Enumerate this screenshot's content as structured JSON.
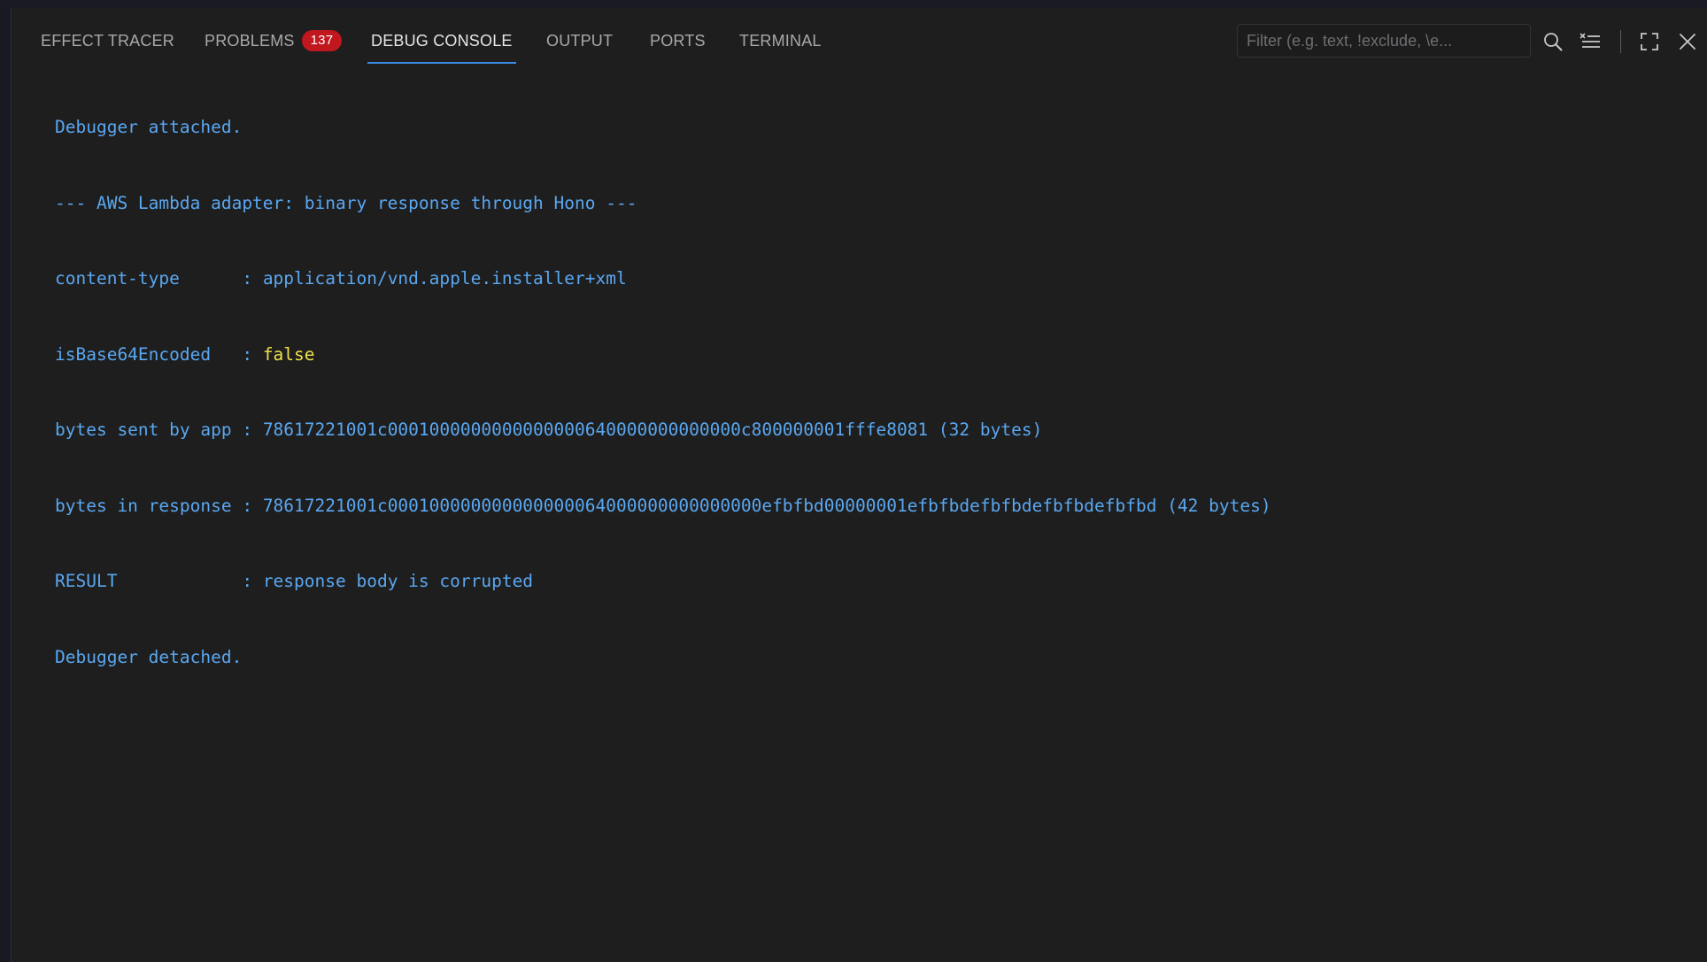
{
  "tabs": [
    {
      "label": "EFFECT TRACER"
    },
    {
      "label": "PROBLEMS",
      "badge": "137"
    },
    {
      "label": "DEBUG CONSOLE"
    },
    {
      "label": "OUTPUT"
    },
    {
      "label": "PORTS"
    },
    {
      "label": "TERMINAL"
    }
  ],
  "active_tab": "DEBUG CONSOLE",
  "filter": {
    "placeholder": "Filter (e.g. text, !exclude, \\e...",
    "value": ""
  },
  "toolbar": {
    "icons": [
      "search-icon",
      "clear-console-icon",
      "maximize-panel-icon",
      "close-panel-icon"
    ]
  },
  "console": {
    "lines": [
      {
        "text": "Debugger attached."
      },
      {
        "text": "--- AWS Lambda adapter: binary response through Hono ---"
      },
      {
        "key": "content-type      : ",
        "value": "application/vnd.apple.installer+xml"
      },
      {
        "key": "isBase64Encoded   : ",
        "value": "false",
        "kind": "bool"
      },
      {
        "key": "bytes sent by app : ",
        "value": "78617221001c0001000000000000000640000000000000c800000001fffe8081 (32 bytes)"
      },
      {
        "key": "bytes in response : ",
        "value": "78617221001c000100000000000000064000000000000000efbfbd00000001efbfbdefbfbdefbfbdefbfbd (42 bytes)"
      },
      {
        "key": "RESULT            : ",
        "value": "response body is corrupted"
      },
      {
        "text": "Debugger detached."
      }
    ]
  },
  "colors": {
    "background": "#1e1e1f",
    "console_text": "#5aa7f0",
    "boolean_value": "#f0e04a",
    "badge": "#c0181e",
    "active_tab_underline": "#3c8ce7"
  }
}
